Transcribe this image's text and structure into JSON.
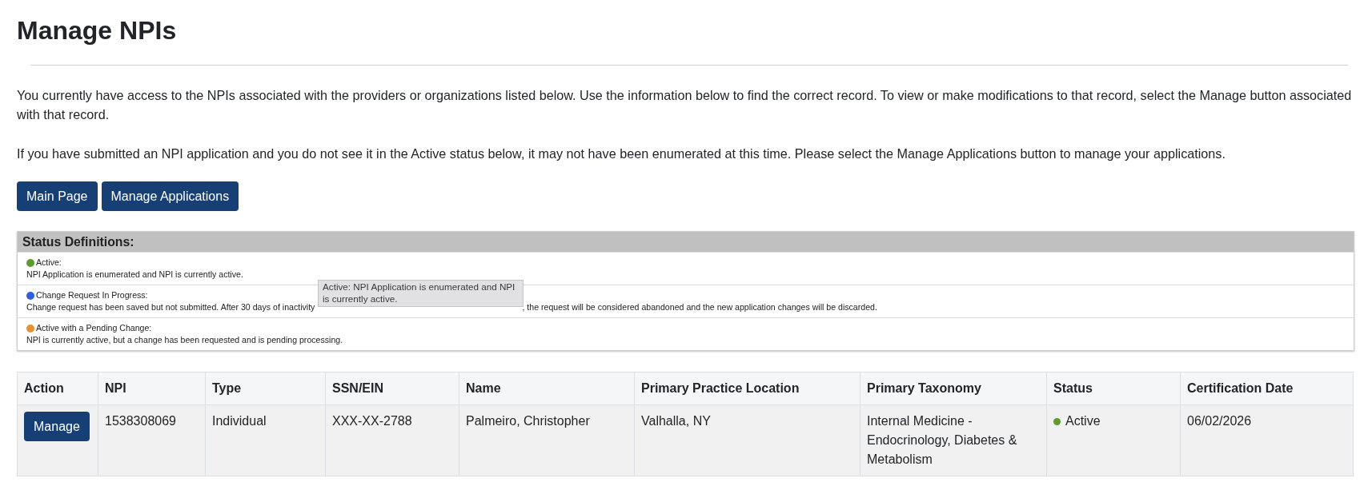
{
  "page": {
    "title": "Manage NPIs"
  },
  "intro": [
    "You currently have access to the NPIs associated with the providers or organizations listed below. Use the information below to find the correct record. To view or make modifications to that record, select the Manage button associated with that record.",
    "If you have submitted an NPI application and you do not see it in the Active status below, it may not have been enumerated at this time. Please select the Manage Applications button to manage your applications."
  ],
  "buttons": [
    {
      "label": "Main Page"
    },
    {
      "label": "Manage Applications"
    }
  ],
  "status_definitions": {
    "title": "Status Definitions:",
    "items": [
      {
        "label": "Active:",
        "description": [
          "NPI Application is enumerated and NPI is currently active."
        ],
        "color": "#5e9b2c"
      },
      {
        "label": "Change Request In Progress:",
        "description": [
          "Change request has been saved but not submitted. After 30 days of inactivity",
          ", the request will be considered abandoned and the new application changes will be discarded."
        ],
        "color": "#2f5fe0"
      },
      {
        "label": "Active with a Pending Change:",
        "description": [
          "NPI is currently active, but a change has been requested and is pending processing."
        ],
        "color": "#e8912f"
      }
    ],
    "tooltip": {
      "text": "Active: NPI Application is enumerated and NPI is currently active."
    }
  },
  "table": {
    "columns": [
      "Action",
      "NPI",
      "Type",
      "SSN/EIN",
      "Name",
      "Primary Practice Location",
      "Primary Taxonomy",
      "Status",
      "Certification Date"
    ],
    "rows": [
      {
        "cells": [
          {
            "kind": "button",
            "text": "Manage"
          },
          {
            "kind": "text",
            "text": "1538308069"
          },
          {
            "kind": "text",
            "text": "Individual"
          },
          {
            "kind": "text",
            "text": "XXX-XX-2788"
          },
          {
            "kind": "text",
            "text": "Palmeiro, Christopher"
          },
          {
            "kind": "text",
            "text": "Valhalla, NY"
          },
          {
            "kind": "text",
            "text": "Internal Medicine - Endocrinology, Diabetes & Metabolism"
          },
          {
            "kind": "status",
            "text": "Active",
            "color": "#5e9b2c"
          },
          {
            "kind": "text",
            "text": "06/02/2026"
          }
        ]
      }
    ]
  }
}
